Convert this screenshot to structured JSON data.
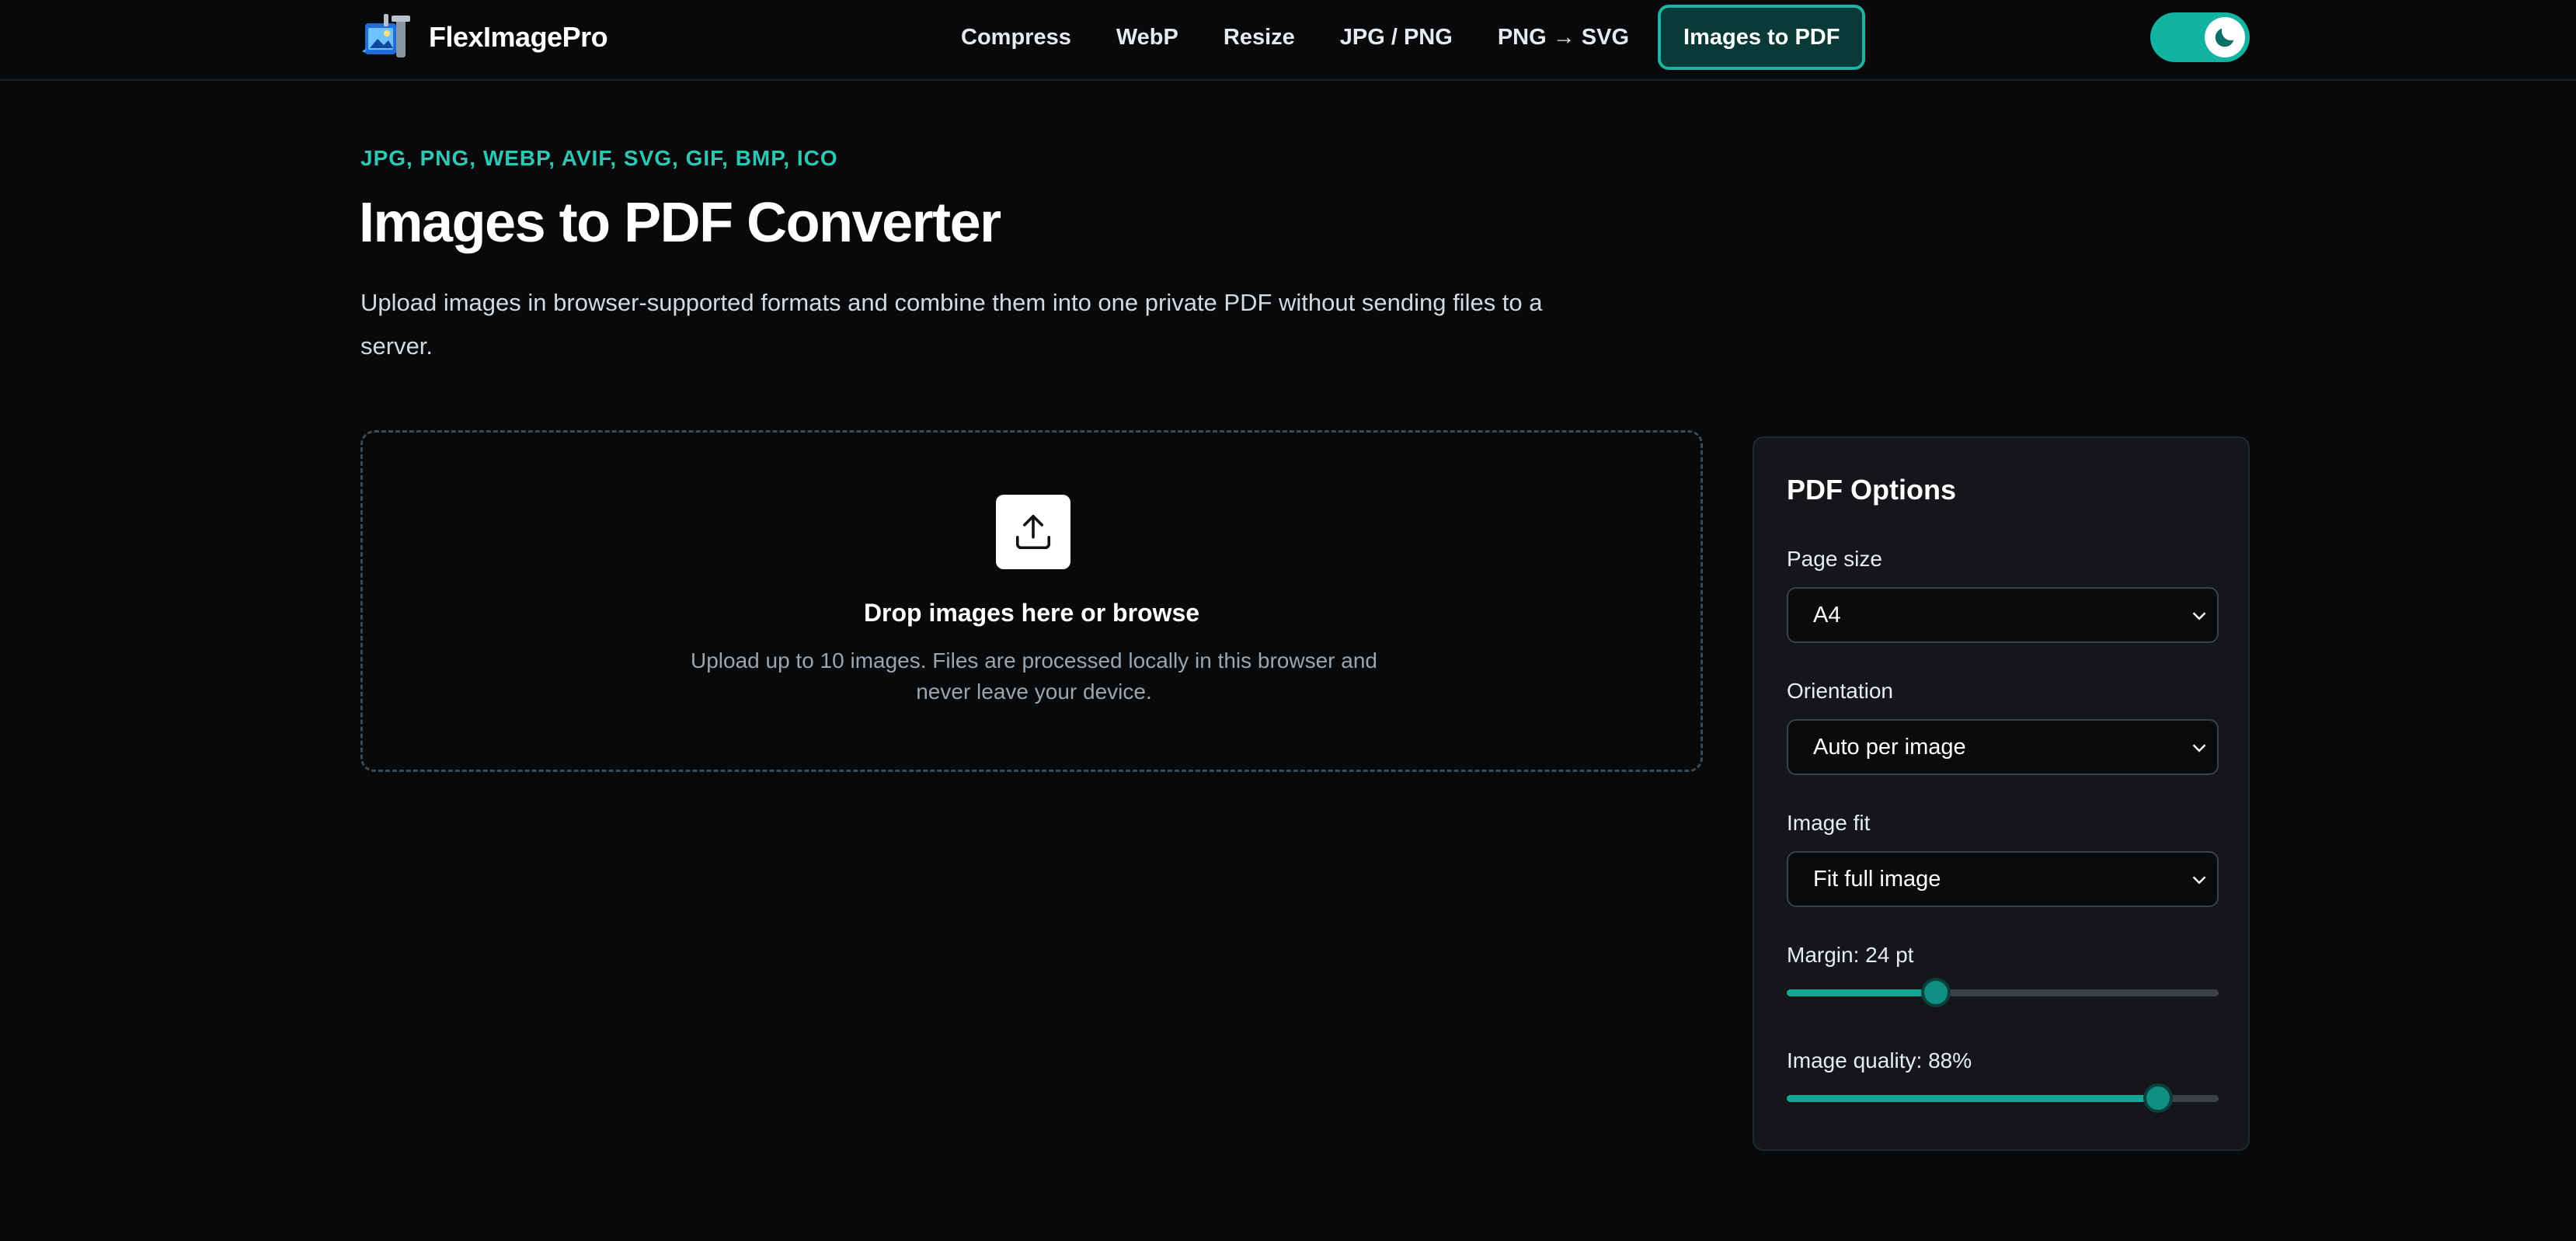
{
  "brand": {
    "name": "FlexImagePro",
    "logo_icon": "vise-image-logo-icon"
  },
  "nav": {
    "items": [
      {
        "label": "Compress"
      },
      {
        "label": "WebP"
      },
      {
        "label": "Resize"
      },
      {
        "label": "JPG / PNG"
      },
      {
        "label": "PNG → SVG"
      },
      {
        "label": "Images to PDF",
        "active": true
      }
    ]
  },
  "theme_toggle": {
    "icon": "moon-icon",
    "state": "dark"
  },
  "hero": {
    "formats": "JPG, PNG, WEBP, AVIF, SVG, GIF, BMP, ICO",
    "title": "Images to PDF Converter",
    "subtitle": "Upload images in browser-supported formats and combine them into one private PDF without sending files to a server."
  },
  "dropzone": {
    "icon": "upload-icon",
    "title": "Drop images here or browse",
    "description": "Upload up to 10 images. Files are processed locally in this browser and never leave your device."
  },
  "options": {
    "title": "PDF Options",
    "page_size": {
      "label": "Page size",
      "value": "A4"
    },
    "orientation": {
      "label": "Orientation",
      "value": "Auto per image"
    },
    "image_fit": {
      "label": "Image fit",
      "value": "Fit full image"
    },
    "margin": {
      "label": "Margin: 24 pt",
      "fraction": 0.345
    },
    "quality": {
      "label": "Image quality: 88%",
      "fraction": 0.86
    }
  },
  "colors": {
    "accent": "#1fb3a2",
    "background": "#07090b",
    "panel": "#141619"
  }
}
